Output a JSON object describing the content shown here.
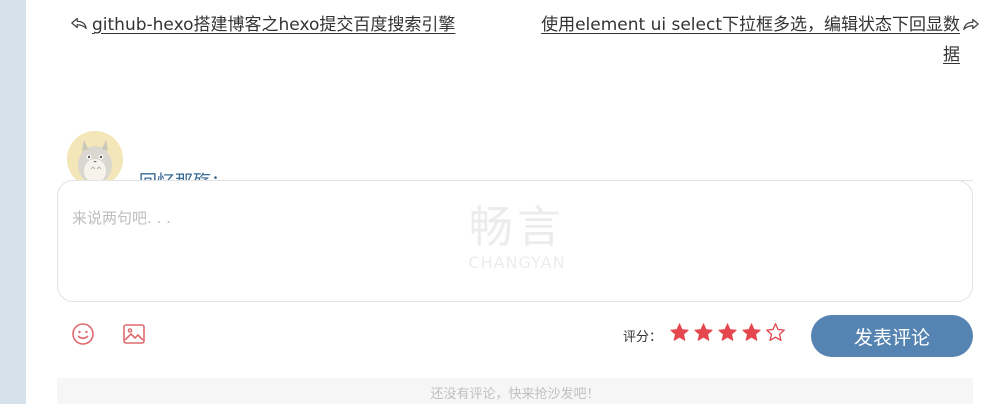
{
  "post_nav": {
    "prev_title": "github-hexo搭建博客之hexo提交百度搜索引擎",
    "next_title": "使用element ui select下拉框多选，编辑状态下回显数据"
  },
  "comment_box": {
    "username": "回忆那殇：",
    "placeholder": "来说两句吧. . .",
    "watermark_cn": "畅言",
    "watermark_en": "CHANGYAN",
    "rating_label": "评分：",
    "rating_value": 4,
    "rating_max": 5,
    "submit_label": "发表评论",
    "empty_notice": "还没有评论，快来抢沙发吧！"
  },
  "colors": {
    "star_active": "#e5474f",
    "accent_blue": "#5584b2",
    "username": "#3a6a96"
  },
  "icons": {
    "prev": "share-left-icon",
    "next": "share-right-icon",
    "emoji": "smiley-icon",
    "image": "image-icon"
  }
}
